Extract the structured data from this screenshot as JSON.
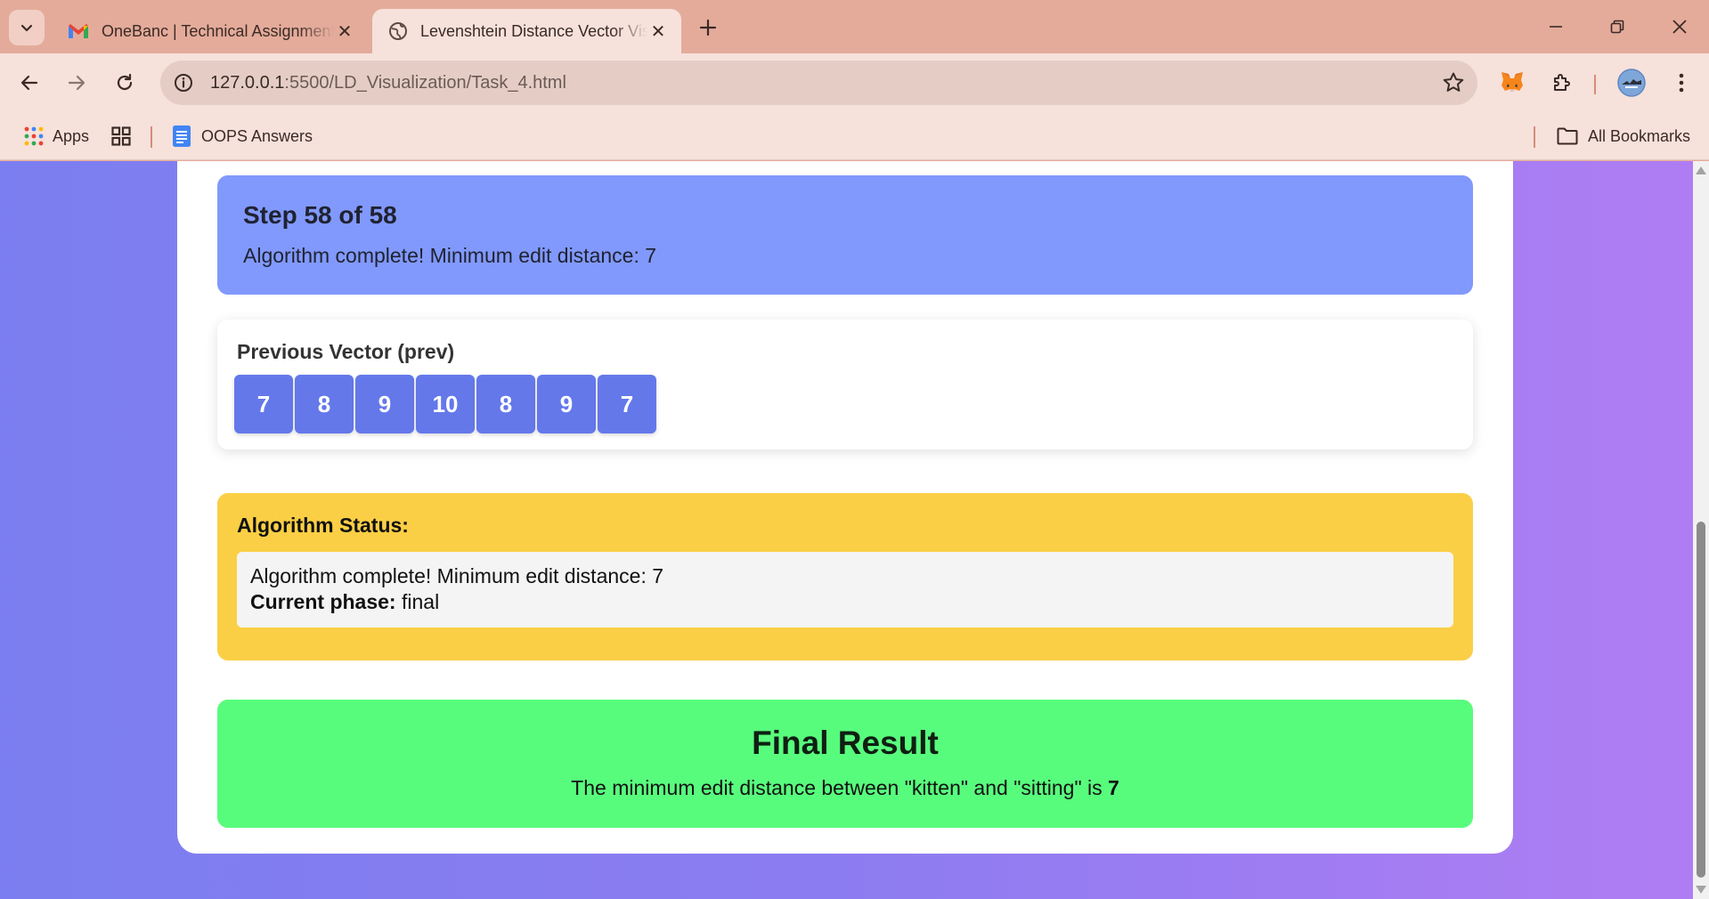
{
  "browser": {
    "tabs": [
      {
        "title": "OneBanc | Technical Assignment",
        "active": false
      },
      {
        "title": "Levenshtein Distance Vector Visualization",
        "active": true
      }
    ],
    "url": {
      "host": "127.0.0.1",
      "rest": ":5500/LD_Visualization/Task_4.html"
    },
    "bookmarks": {
      "apps": "Apps",
      "oops": "OOPS Answers",
      "all": "All Bookmarks"
    }
  },
  "page": {
    "step": {
      "title": "Step 58 of 58",
      "description": "Algorithm complete! Minimum edit distance: 7"
    },
    "vector": {
      "title": "Previous Vector (prev)",
      "values": [
        "7",
        "8",
        "9",
        "10",
        "8",
        "9",
        "7"
      ]
    },
    "status": {
      "title": "Algorithm Status:",
      "message": "Algorithm complete! Minimum edit distance: 7",
      "phase_label": "Current phase:",
      "phase_value": "final"
    },
    "result": {
      "title": "Final Result",
      "prefix": "The minimum edit distance between \"kitten\" and \"sitting\" is",
      "value": "7"
    }
  },
  "colors": {
    "step_panel": "#8199fc",
    "vector_cell": "#6478ea",
    "status_panel": "#fbcf45",
    "result_panel": "#58fc7d",
    "chrome_tabbar": "#e4ab9a"
  },
  "icons": [
    "tab-search-icon",
    "gmail-icon",
    "globe-icon",
    "close-icon",
    "plus-icon",
    "minimize-icon",
    "restore-icon",
    "back-icon",
    "forward-icon",
    "reload-icon",
    "info-icon",
    "star-icon",
    "metamask-icon",
    "puzzle-icon",
    "avatar",
    "kebab-icon",
    "apps-grid-icon",
    "grid-icon",
    "docs-icon",
    "folder-icon"
  ]
}
